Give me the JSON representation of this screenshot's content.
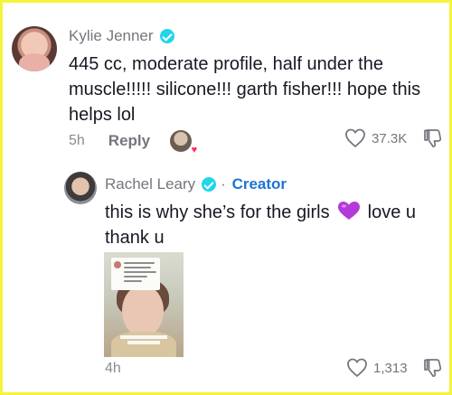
{
  "comment": {
    "username": "Kylie Jenner",
    "text_line1": "445 cc, moderate profile, half under the",
    "text_line2": "muscle!!!!! silicone!!! garth fisher!!! hope this",
    "text_line3": "helps lol",
    "time": "5h",
    "reply_label": "Reply",
    "like_count": "37.3K"
  },
  "reply": {
    "username": "Rachel Leary",
    "separator": "·",
    "creator_label": "Creator",
    "text_part1": "this is why she’s for the girls",
    "text_part2": "love u",
    "text_line2": "thank u",
    "time": "4h",
    "like_count": "1,313"
  },
  "colors": {
    "frame_border": "#f4f43a",
    "verified": "#20d5ec",
    "creator": "#1f73d6",
    "heart": "#b43ad8"
  },
  "icons": {
    "verified": "verified-check-icon",
    "like": "heart-outline-icon",
    "dislike": "thumbs-down-icon",
    "emoji": "purple-heart-emoji"
  }
}
